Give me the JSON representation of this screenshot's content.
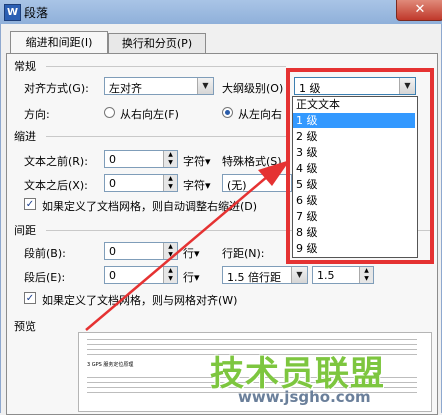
{
  "window": {
    "icon_letter": "W",
    "title": "段落",
    "close_label": "✕"
  },
  "tabs": [
    {
      "label": "缩进和间距(I)"
    },
    {
      "label": "换行和分页(P)"
    }
  ],
  "general": {
    "section_title": "常规",
    "alignment_label": "对齐方式(G):",
    "alignment_value": "左对齐",
    "outline_label": "大纲级别(O)",
    "outline_value": "1 级",
    "direction_label": "方向:",
    "rtl_label": "从右向左(F)",
    "ltr_label": "从左向右"
  },
  "outline_options": [
    "正文文本",
    "1 级",
    "2 级",
    "3 级",
    "4 级",
    "5 级",
    "6 级",
    "7 级",
    "8 级",
    "9 级"
  ],
  "indent": {
    "section_title": "缩进",
    "before_label": "文本之前(R):",
    "before_value": "0",
    "before_unit": "字符▾",
    "after_label": "文本之后(X):",
    "after_value": "0",
    "after_unit": "字符▾",
    "special_label": "特殊格式(S)",
    "special_value": "(无)",
    "grid_checkbox": "如果定义了文档网格，则自动调整右缩进(D)"
  },
  "spacing": {
    "section_title": "间距",
    "before_label": "段前(B):",
    "before_value": "0",
    "before_unit": "行▾",
    "after_label": "段后(E):",
    "after_value": "0",
    "after_unit": "行▾",
    "line_label": "行距(N):",
    "line_value": "1.5 倍行距",
    "setting_value": "1.5",
    "grid_checkbox": "如果定义了文档网格，则与网格对齐(W)"
  },
  "preview": {
    "section_title": "预览",
    "sample_text": "3 GPS 服务定位原理"
  },
  "watermark": {
    "brand": "技术员联盟",
    "url": "www.jsgho.com"
  },
  "colors": {
    "highlight": "#e53232",
    "selection": "#3399ff",
    "watermark": "#7dc63f"
  }
}
